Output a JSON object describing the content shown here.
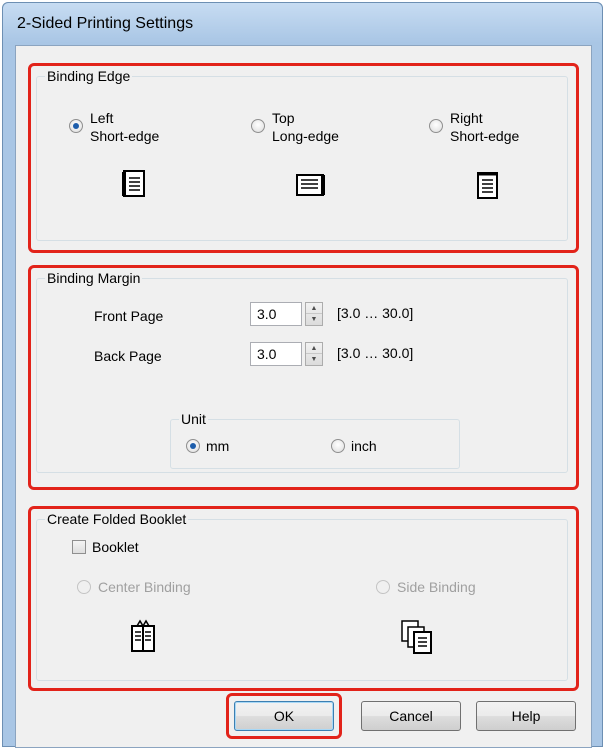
{
  "dialog": {
    "title": "2-Sided Printing Settings"
  },
  "binding_edge": {
    "label": "Binding Edge",
    "options": [
      {
        "line1": "Left",
        "line2": "Short-edge",
        "selected": true,
        "icon": "page-left-binding-icon"
      },
      {
        "line1": "Top",
        "line2": "Long-edge",
        "selected": false,
        "icon": "page-top-binding-icon"
      },
      {
        "line1": "Right",
        "line2": "Short-edge",
        "selected": false,
        "icon": "page-right-binding-icon"
      }
    ]
  },
  "binding_margin": {
    "label": "Binding Margin",
    "front_page": {
      "label": "Front Page",
      "value": "3.0",
      "range": "[3.0 … 30.0]"
    },
    "back_page": {
      "label": "Back Page",
      "value": "3.0",
      "range": "[3.0 … 30.0]"
    },
    "unit": {
      "label": "Unit",
      "options": [
        {
          "label": "mm",
          "selected": true
        },
        {
          "label": "inch",
          "selected": false
        }
      ]
    }
  },
  "folded_booklet": {
    "label": "Create Folded Booklet",
    "booklet_checkbox": {
      "label": "Booklet",
      "checked": false
    },
    "options": [
      {
        "label": "Center Binding",
        "enabled": false,
        "icon": "center-binding-booklet-icon"
      },
      {
        "label": "Side Binding",
        "enabled": false,
        "icon": "side-binding-booklet-icon"
      }
    ]
  },
  "buttons": {
    "ok": "OK",
    "cancel": "Cancel",
    "help": "Help"
  },
  "colors": {
    "highlight": "#e2231a",
    "window_frame": "#a9c6e5",
    "dialog_bg": "#f0f0f0"
  }
}
